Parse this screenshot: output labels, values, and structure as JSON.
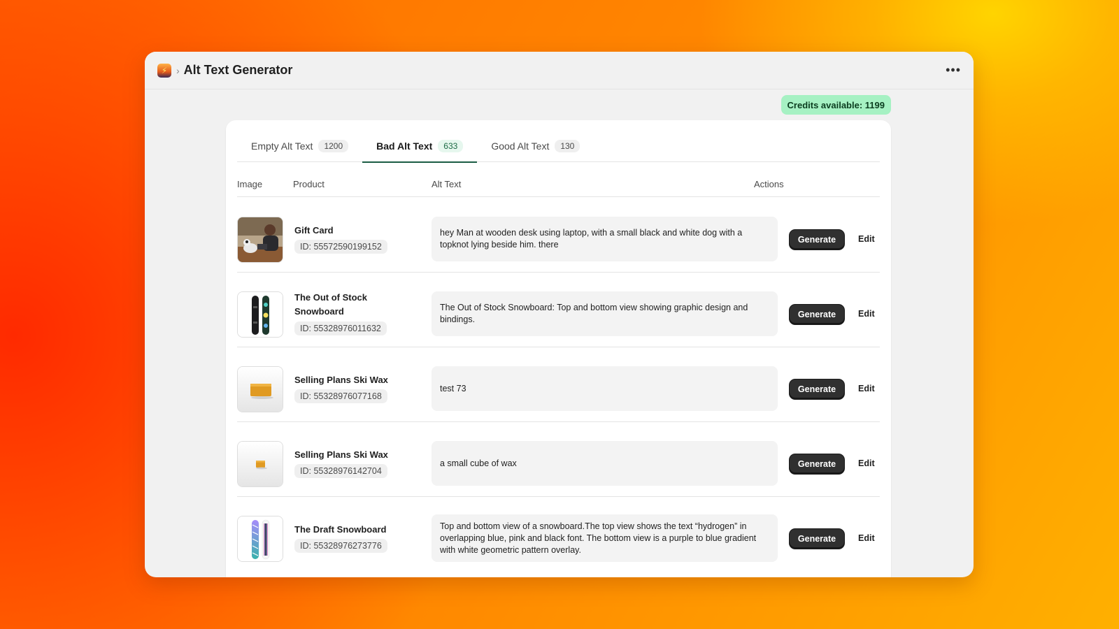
{
  "app": {
    "title": "Alt Text Generator",
    "separator": "›",
    "menu": "•••"
  },
  "credits": {
    "text": "Credits available: 1199"
  },
  "tabs": [
    {
      "label": "Empty Alt Text",
      "count": "1200"
    },
    {
      "label": "Bad Alt Text",
      "count": "633"
    },
    {
      "label": "Good Alt Text",
      "count": "130"
    }
  ],
  "columns": {
    "image": "Image",
    "product": "Product",
    "alt": "Alt Text",
    "actions": "Actions"
  },
  "rows": [
    {
      "name": "Gift Card",
      "id": "ID: 55572590199152",
      "alt": "hey Man at wooden desk using laptop, with a small black and white dog with a topknot lying beside him. there",
      "generate": "Generate",
      "edit": "Edit"
    },
    {
      "name": "The Out of Stock Snowboard",
      "id": "ID: 55328976011632",
      "alt": "The Out of Stock Snowboard: Top and bottom view showing graphic design and bindings.",
      "generate": "Generate",
      "edit": "Edit"
    },
    {
      "name": "Selling Plans Ski Wax",
      "id": "ID: 55328976077168",
      "alt": "test 73",
      "generate": "Generate",
      "edit": "Edit"
    },
    {
      "name": "Selling Plans Ski Wax",
      "id": "ID: 55328976142704",
      "alt": "a small cube of wax",
      "generate": "Generate",
      "edit": "Edit"
    },
    {
      "name": "The Draft Snowboard",
      "id": "ID: 55328976273776",
      "alt": "Top and bottom view of a snowboard.The top view shows the text “hydrogen” in overlapping blue, pink and black font. The bottom view is a purple to blue gradient with white geometric pattern overlay.",
      "generate": "Generate",
      "edit": "Edit"
    }
  ]
}
